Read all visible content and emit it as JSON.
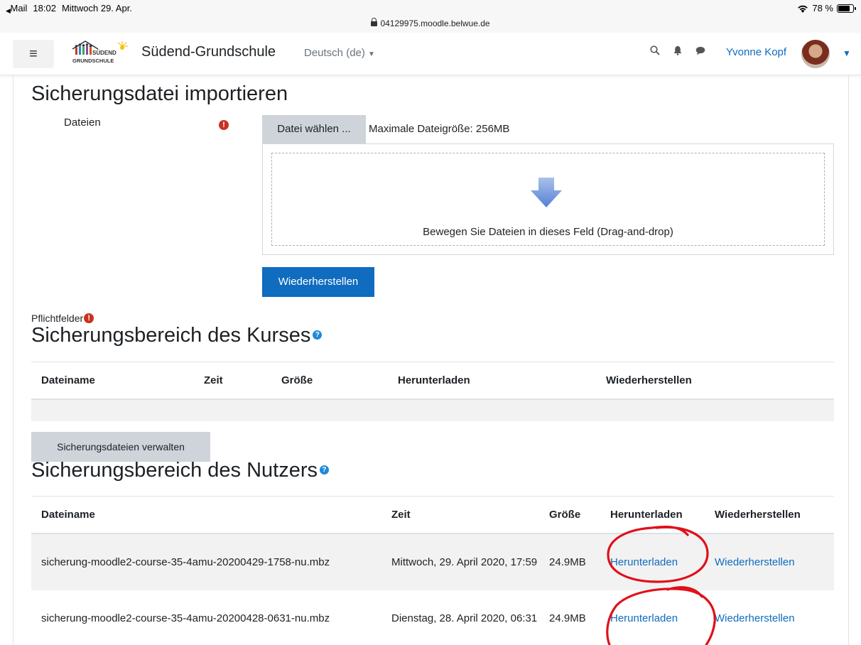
{
  "status_bar": {
    "back_app": "Mail",
    "time": "18:02",
    "date": "Mittwoch 29. Apr.",
    "url": "04129975.moodle.belwue.de",
    "battery": "78 %",
    "battery_level": 0.78
  },
  "navbar": {
    "logo_text": "SÜDEND GRUNDSCHULE",
    "site_name": "Südend-Grundschule",
    "language": "Deutsch (de)",
    "user_name": "Yvonne Kopf"
  },
  "import": {
    "title": "Sicherungsdatei importieren",
    "files_label": "Dateien",
    "choose_button": "Datei wählen ...",
    "max_size": "Maximale Dateigröße: 256MB",
    "drop_text": "Bewegen Sie Dateien in dieses Feld (Drag-and-drop)",
    "restore_button": "Wiederherstellen",
    "required_note": "Pflichtfelder"
  },
  "course_backup": {
    "title": "Sicherungsbereich des Kurses",
    "columns": [
      "Dateiname",
      "Zeit",
      "Größe",
      "Herunterladen",
      "Wiederherstellen"
    ],
    "manage_button": "Sicherungsdateien verwalten"
  },
  "user_backup": {
    "title": "Sicherungsbereich des Nutzers",
    "columns": [
      "Dateiname",
      "Zeit",
      "Größe",
      "Herunterladen",
      "Wiederherstellen"
    ],
    "rows": [
      {
        "filename": "sicherung-moodle2-course-35-4amu-20200429-1758-nu.mbz",
        "time": "Mittwoch, 29. April 2020, 17:59",
        "size": "24.9MB",
        "download": "Herunterladen",
        "restore": "Wiederherstellen"
      },
      {
        "filename": "sicherung-moodle2-course-35-4amu-20200428-0631-nu.mbz",
        "time": "Dienstag, 28. April 2020, 06:31",
        "size": "24.9MB",
        "download": "Herunterladen",
        "restore": "Wiederherstellen"
      }
    ]
  },
  "colors": {
    "link": "#0f6cbf",
    "primary_button": "#0f6cbf",
    "required": "#ca3120",
    "annotation": "#e0101a"
  }
}
